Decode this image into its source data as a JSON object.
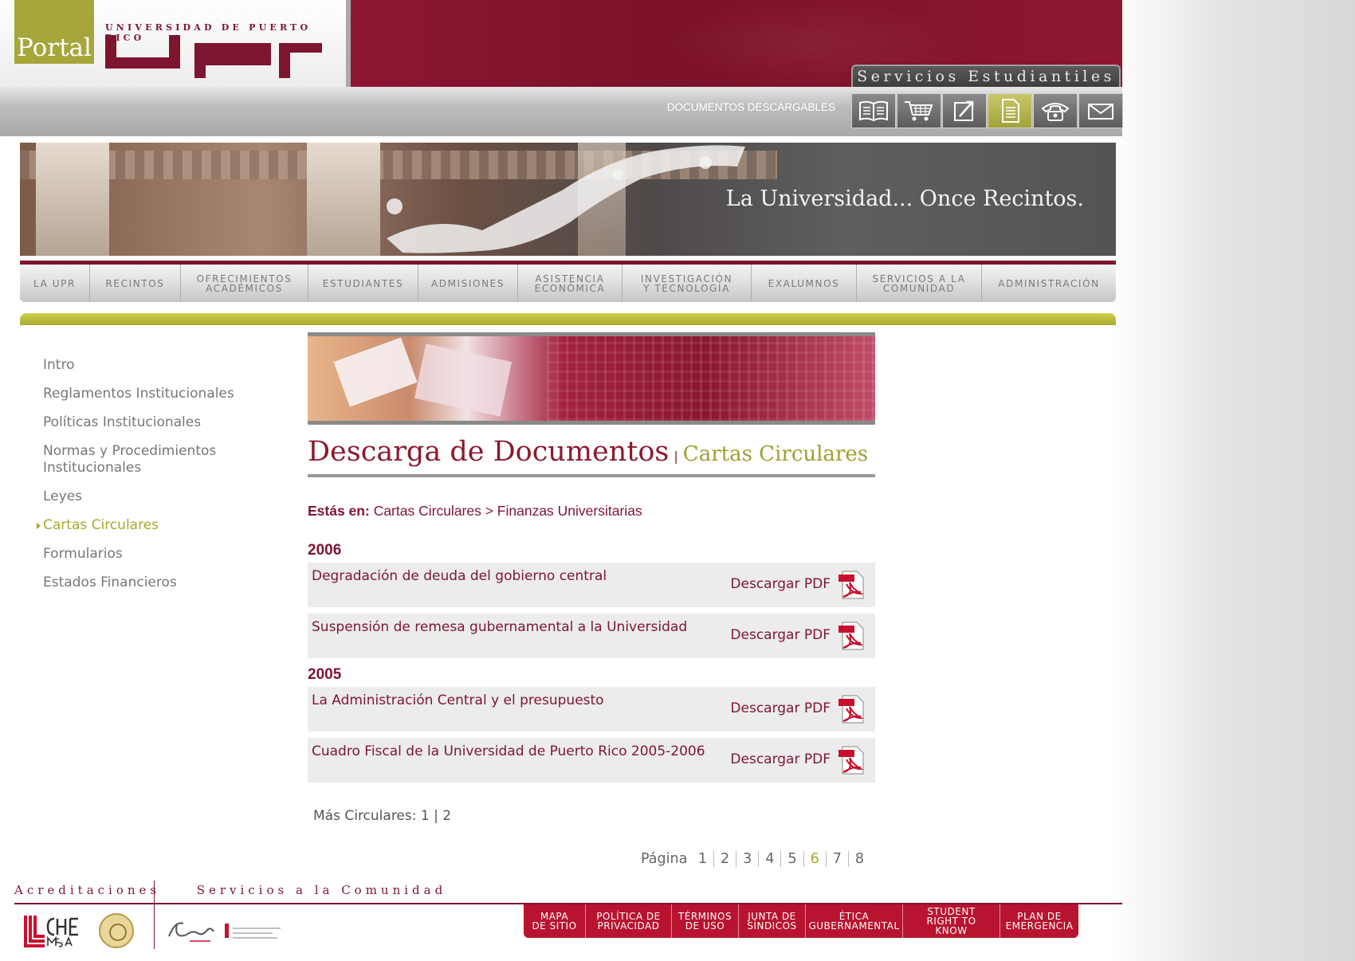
{
  "header": {
    "portal_label": "Portal",
    "university_name": "UNIVERSIDAD DE PUERTO RICO",
    "section_tab": "Servicios Estudiantiles",
    "documents_label": "DOCUMENTOS DESCARGABLES",
    "icons": [
      "book-icon",
      "cart-icon",
      "link-icon",
      "document-icon",
      "phone-icon",
      "mail-icon"
    ],
    "active_icon": "document-icon"
  },
  "banner": {
    "tagline": "La Universidad... Once Recintos."
  },
  "menu": {
    "items": [
      "LA UPR",
      "RECINTOS",
      "OFRECIMIENTOS\nACADÉMICOS",
      "ESTUDIANTES",
      "ADMISIONES",
      "ASISTENCIA\nECONÓMICA",
      "INVESTIGACIÓN\nY TECNOLOGÍA",
      "EXALUMNOS",
      "SERVICIOS A LA\nCOMUNIDAD",
      "ADMINISTRACIÓN"
    ]
  },
  "sidebar": {
    "items": [
      "Intro",
      "Reglamentos Institucionales",
      "Políticas Institucionales",
      "Normas y Procedimientos Institucionales",
      "Leyes",
      "Cartas Circulares",
      "Formularios",
      "Estados Financieros"
    ],
    "active_index": 5
  },
  "content": {
    "title": "Descarga de Documentos",
    "separator": "|",
    "subtitle": "Cartas Circulares",
    "breadcrumb_prefix": "Estás en:",
    "breadcrumb": "Cartas Circulares > Finanzas Universitarias",
    "download_label": "Descargar PDF",
    "groups": [
      {
        "year": "2006",
        "docs": [
          "Degradación de deuda del gobierno central",
          "Suspensión de remesa gubernamental a la Universidad"
        ]
      },
      {
        "year": "2005",
        "docs": [
          "La Administración Central y el presupuesto",
          "Cuadro Fiscal de la Universidad de Puerto Rico 2005-2006"
        ]
      }
    ],
    "more_label": "Más Circulares:",
    "more_pages": [
      "1",
      "2"
    ],
    "more_sep": "|",
    "pagination_label": "Página",
    "pages": [
      "1",
      "2",
      "3",
      "4",
      "5",
      "6",
      "7",
      "8"
    ],
    "current_page": "6"
  },
  "footer": {
    "accreditations_label": "Acreditaciones",
    "community_label": "Servicios a la Comunidad",
    "nav": [
      "MAPA\nDE SITIO",
      "POLÍTICA DE\nPRIVACIDAD",
      "TÉRMINOS\nDE USO",
      "JUNTA DE\nSÍNDICOS",
      "ÉTICA\nGUBERNAMENTAL",
      "STUDENT\nRIGHT TO KNOW",
      "PLAN DE\nEMERGENCIA"
    ]
  },
  "colors": {
    "maroon": "#7e1530",
    "olive": "#a8a82c",
    "footer_red": "#b8142f"
  }
}
